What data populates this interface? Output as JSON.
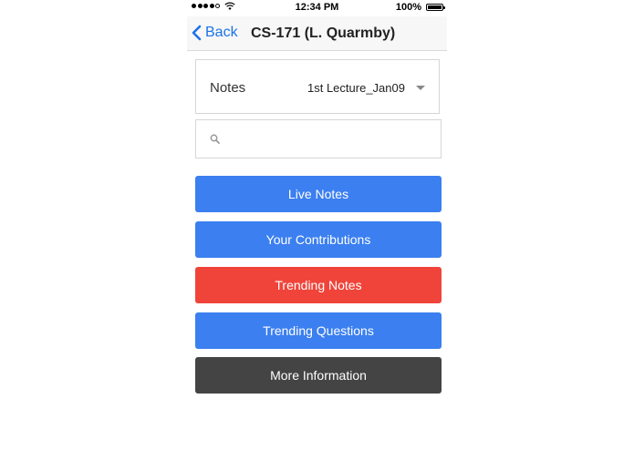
{
  "status_bar": {
    "time": "12:34 PM",
    "battery_percent": "100%",
    "signal_bars_filled": 4,
    "signal_bars_total": 5
  },
  "nav": {
    "back_label": "Back",
    "title": "CS-171 (L. Quarmby)"
  },
  "notes_selector": {
    "label": "Notes",
    "selected_value": "1st Lecture_Jan09"
  },
  "search": {
    "value": "",
    "placeholder": ""
  },
  "buttons": [
    {
      "label": "Live Notes",
      "color": "#3b7ff0"
    },
    {
      "label": "Your Contributions",
      "color": "#3b7ff0"
    },
    {
      "label": "Trending Notes",
      "color": "#f0443a"
    },
    {
      "label": "Trending Questions",
      "color": "#3b7ff0"
    },
    {
      "label": "More Information",
      "color": "#444444"
    }
  ],
  "colors": {
    "accent": "#1a73e8"
  }
}
